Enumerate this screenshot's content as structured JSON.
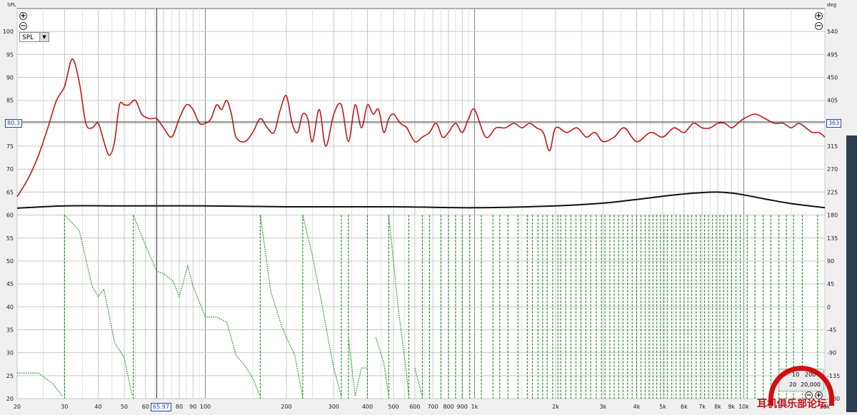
{
  "labels": {
    "y_left_title": "SPL",
    "y_right_title": "deg",
    "spl_selector": "SPL",
    "cursor_y": "80.3",
    "cursor_x": "65.97",
    "cursor_phase": "363"
  },
  "range_panel": {
    "a": "10",
    "b": "200",
    "c": "20",
    "d": "20,000"
  },
  "watermark": {
    "text": "耳机俱乐部论坛"
  },
  "colors": {
    "spl": "#c01818",
    "black": "#111111",
    "phase": "#1f8a1f",
    "grid": "#c8c8c8",
    "plot_bg": "#ffffff"
  },
  "chart_data": {
    "type": "line",
    "x_scale": "log",
    "xlim": [
      20,
      20000
    ],
    "ylim": [
      20,
      105
    ],
    "y2lim": [
      -180,
      585
    ],
    "grid": true,
    "x_ticks": [
      {
        "v": 20,
        "t": "20"
      },
      {
        "v": 30,
        "t": "30"
      },
      {
        "v": 40,
        "t": "40"
      },
      {
        "v": 50,
        "t": "50"
      },
      {
        "v": 60,
        "t": "60"
      },
      {
        "v": 70,
        "t": "70"
      },
      {
        "v": 80,
        "t": "80"
      },
      {
        "v": 90,
        "t": "90"
      },
      {
        "v": 100,
        "t": "100"
      },
      {
        "v": 200,
        "t": "200"
      },
      {
        "v": 300,
        "t": "300"
      },
      {
        "v": 400,
        "t": "400"
      },
      {
        "v": 500,
        "t": "500"
      },
      {
        "v": 600,
        "t": "600"
      },
      {
        "v": 700,
        "t": "700"
      },
      {
        "v": 800,
        "t": "800"
      },
      {
        "v": 900,
        "t": "900"
      },
      {
        "v": 1000,
        "t": "1k"
      },
      {
        "v": 2000,
        "t": "2k"
      },
      {
        "v": 3000,
        "t": "3k"
      },
      {
        "v": 4000,
        "t": "4k"
      },
      {
        "v": 5000,
        "t": "5k"
      },
      {
        "v": 6000,
        "t": "6k"
      },
      {
        "v": 7000,
        "t": "7k"
      },
      {
        "v": 8000,
        "t": "8k"
      },
      {
        "v": 9000,
        "t": "9k"
      },
      {
        "v": 10000,
        "t": "10k"
      },
      {
        "v": 20000,
        "t": "20k"
      }
    ],
    "y_ticks": [
      20,
      25,
      30,
      35,
      40,
      45,
      50,
      55,
      60,
      65,
      70,
      75,
      80,
      85,
      90,
      95,
      100
    ],
    "y2_ticks": [
      -180,
      -135,
      -90,
      -45,
      0,
      45,
      90,
      135,
      180,
      225,
      270,
      315,
      363,
      405,
      450,
      495,
      540
    ],
    "cursor": {
      "x": 65.97,
      "y": 80.3
    },
    "series": [
      {
        "key": "spl",
        "x": [
          20,
          22,
          24,
          26,
          28,
          30,
          32,
          34,
          36,
          38,
          40,
          42,
          44,
          46,
          48,
          50,
          52,
          55,
          58,
          62,
          66,
          70,
          75,
          80,
          85,
          90,
          95,
          100,
          105,
          110,
          115,
          120,
          125,
          130,
          140,
          150,
          160,
          170,
          180,
          190,
          200,
          210,
          220,
          230,
          240,
          250,
          265,
          280,
          300,
          320,
          340,
          360,
          380,
          400,
          420,
          440,
          460,
          480,
          500,
          530,
          560,
          600,
          640,
          680,
          720,
          760,
          800,
          850,
          900,
          950,
          1000,
          1100,
          1200,
          1300,
          1400,
          1500,
          1600,
          1700,
          1800,
          1900,
          2000,
          2200,
          2400,
          2600,
          2800,
          3000,
          3300,
          3600,
          4000,
          4500,
          5000,
          5500,
          6000,
          6500,
          7000,
          7500,
          8000,
          8500,
          9000,
          9500,
          10000,
          11000,
          12000,
          13000,
          14000,
          15000,
          16000,
          17000,
          18000,
          19000,
          20000
        ],
        "y": [
          64,
          68,
          73,
          79,
          85,
          88,
          94,
          89,
          80,
          79,
          80,
          76,
          73,
          76,
          84,
          84,
          84,
          85,
          82,
          81,
          81,
          79,
          77,
          81,
          84,
          83,
          80,
          80,
          81,
          84,
          83,
          85,
          82,
          77,
          76,
          78,
          81,
          79,
          78,
          83,
          86,
          80,
          78,
          82,
          81,
          76,
          83,
          75,
          82,
          84,
          76,
          84,
          79,
          84,
          82,
          83,
          78,
          81,
          82,
          80,
          79,
          76,
          77,
          78,
          80,
          77,
          78,
          80,
          78,
          81,
          83,
          77,
          79,
          79,
          80,
          79,
          80,
          79,
          78,
          74,
          79,
          78,
          79,
          77,
          78,
          76,
          77,
          79,
          76,
          78,
          77,
          79,
          78,
          80,
          79,
          79,
          80,
          80,
          79,
          80,
          81,
          82,
          81,
          80,
          80,
          79,
          80,
          79,
          78,
          78,
          77
        ]
      },
      {
        "key": "black",
        "x": [
          20,
          30,
          50,
          100,
          200,
          500,
          1000,
          2000,
          3000,
          4000,
          5000,
          6000,
          7000,
          8000,
          9000,
          10000,
          12000,
          15000,
          20000
        ],
        "y": [
          61.5,
          62,
          62,
          62,
          61.8,
          61.8,
          61.6,
          62,
          62.6,
          63.4,
          64.1,
          64.6,
          64.9,
          65,
          64.8,
          64.4,
          63.5,
          62.5,
          61.6
        ]
      }
    ],
    "phase": {
      "wraps": [
        30,
        54,
        160,
        230,
        320,
        340,
        400,
        480,
        570,
        640,
        680,
        750,
        800,
        850,
        900,
        960,
        1060,
        1170,
        1240,
        1330,
        1450,
        1570,
        1640,
        1720,
        1790,
        1860,
        1950,
        2040,
        2090,
        2180,
        2280,
        2380,
        2480,
        2590,
        2700,
        2830,
        2960,
        3050,
        3180,
        3300,
        3430,
        3560,
        3700,
        3850,
        4000,
        4150,
        4300,
        4450,
        4600,
        4750,
        4900,
        5050,
        5200,
        5400,
        5600,
        5800,
        6000,
        6200,
        6400,
        6650,
        6900,
        7150,
        7400,
        7650,
        7900,
        8150,
        8400,
        8700,
        9000,
        9350,
        9700,
        10300,
        11000,
        11800,
        12600,
        13500,
        14400,
        15300,
        16500,
        18800
      ],
      "x": [
        20,
        24,
        27,
        29.5,
        30,
        34,
        38,
        40,
        42,
        46,
        50,
        53.5,
        54,
        60,
        66,
        70,
        76,
        80,
        86,
        90,
        95,
        100,
        110,
        120,
        130,
        140,
        150,
        159.5,
        160,
        175,
        190,
        200,
        215,
        229.5,
        230,
        250,
        270,
        290,
        300,
        319.5,
        320,
        339.5,
        340,
        360,
        380,
        399.5,
        400,
        430,
        460,
        479.5,
        480,
        520,
        560,
        569.5,
        570,
        600,
        639.5,
        640,
        679.5,
        680,
        749.5,
        750,
        799.5,
        800
      ],
      "y": [
        -130,
        -130,
        -150,
        -175,
        180,
        150,
        40,
        20,
        35,
        -70,
        -100,
        -175,
        180,
        120,
        70,
        65,
        50,
        20,
        80,
        40,
        10,
        -20,
        -20,
        -30,
        -95,
        -115,
        -140,
        -175,
        180,
        30,
        -30,
        -60,
        -95,
        -175,
        180,
        100,
        10,
        -80,
        -120,
        -175,
        180,
        -60,
        -60,
        -175,
        -120,
        -120,
        180,
        -60,
        -110,
        -175,
        180,
        0,
        -135,
        -175,
        180,
        -120,
        -175,
        180,
        -175,
        180,
        -175,
        180,
        -175,
        180
      ]
    }
  }
}
